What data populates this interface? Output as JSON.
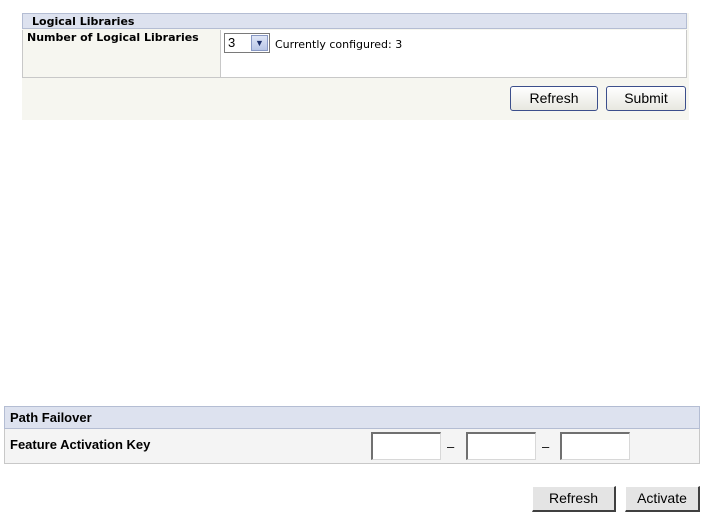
{
  "logical_libraries": {
    "title": "Logical Libraries",
    "row_label": "Number of Logical Libraries",
    "select_value": "3",
    "current_text": "Currently configured: 3",
    "refresh_label": "Refresh",
    "submit_label": "Submit"
  },
  "path_failover": {
    "title": "Path Failover",
    "row_label": "Feature Activation Key",
    "key_part_1": "",
    "key_part_2": "",
    "key_part_3": "",
    "separator": "–",
    "refresh_label": "Refresh",
    "activate_label": "Activate"
  },
  "icons": {
    "dropdown_arrow": "chevron-down-icon"
  }
}
